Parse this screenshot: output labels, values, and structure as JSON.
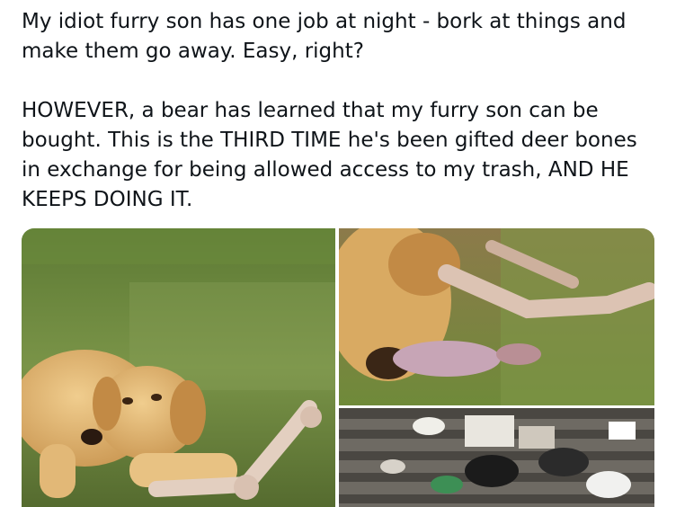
{
  "post": {
    "paragraph_1": "My idiot furry son has one job at night - bork at things and make them go away. Easy, right?",
    "paragraph_2": "HOWEVER, a bear has learned that my furry son can be bought. This is the THIRD TIME he's been gifted deer bones in exchange for being allowed access to my trash, AND HE KEEPS DOING IT."
  },
  "media": {
    "photos": [
      {
        "icon": "dog-with-bone-photo"
      },
      {
        "icon": "dog-sniffing-bone-photo"
      },
      {
        "icon": "scattered-trash-photo"
      }
    ]
  },
  "colors": {
    "text": "#0f1419",
    "background": "#ffffff",
    "grass": "#6f8a3a",
    "dog_fur": "#d9aa62"
  }
}
